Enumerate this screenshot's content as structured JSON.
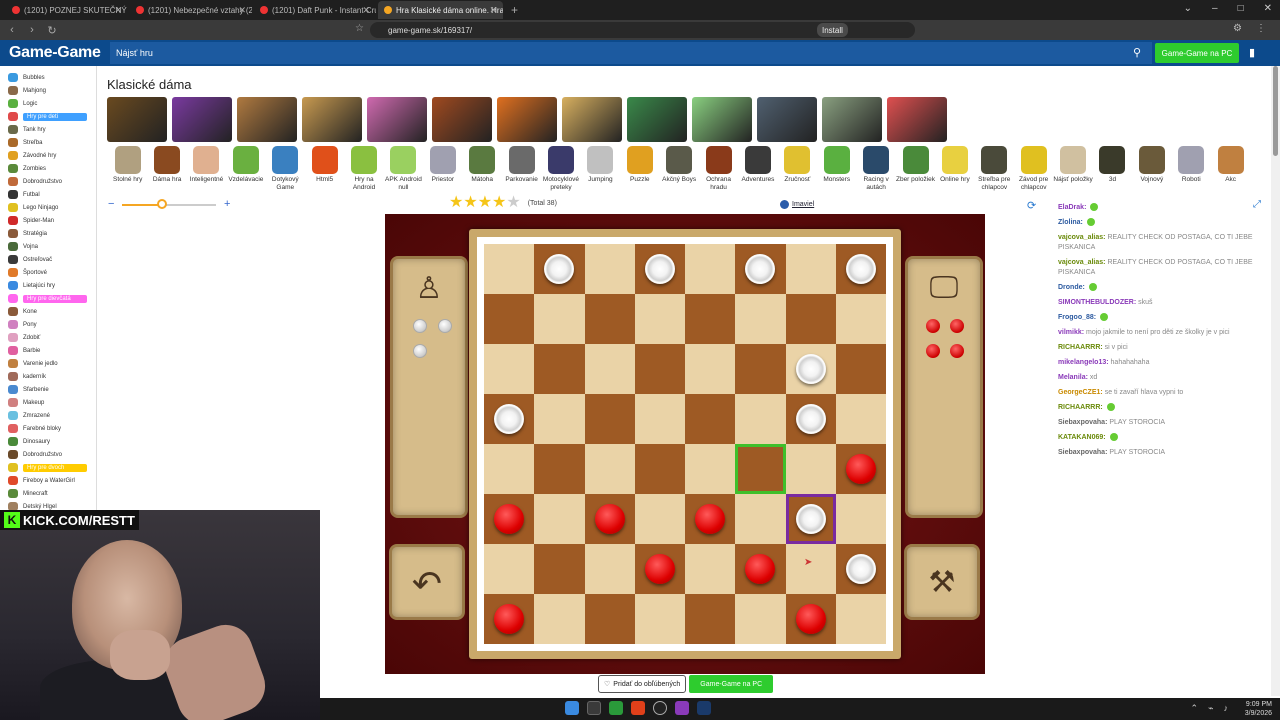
{
  "browser": {
    "tabs": [
      {
        "label": "(1201) POZNEJ SKUTEČNÝ PÁRI - Yo",
        "active": false
      },
      {
        "label": "(1201) Nebezpečné vztahy (2019/24)",
        "active": false
      },
      {
        "label": "(1201) Daft Punk - Instant Crush (Off",
        "active": false
      },
      {
        "label": "Hra Klasické dáma online. Hra",
        "active": true
      }
    ],
    "url": "game-game.sk/169317/",
    "install_label": "Install"
  },
  "site": {
    "logo": "Game-Game",
    "search_placeholder": "Nájsť hru",
    "pc_button": "Game-Game na PC"
  },
  "sidebar": {
    "items": [
      {
        "label": "Bubbles",
        "style": ""
      },
      {
        "label": "Mahjong",
        "style": ""
      },
      {
        "label": "Logic",
        "style": ""
      },
      {
        "label": "Hry pre deti",
        "style": "hl"
      },
      {
        "label": "Tank hry",
        "style": ""
      },
      {
        "label": "Streľba",
        "style": ""
      },
      {
        "label": "Závodné hry",
        "style": ""
      },
      {
        "label": "Zombies",
        "style": ""
      },
      {
        "label": "Dobrodružstvo",
        "style": ""
      },
      {
        "label": "Futbal",
        "style": ""
      },
      {
        "label": "Lego Ninjago",
        "style": ""
      },
      {
        "label": "Spider-Man",
        "style": ""
      },
      {
        "label": "Stratégia",
        "style": ""
      },
      {
        "label": "Vojna",
        "style": ""
      },
      {
        "label": "Ostreľovač",
        "style": ""
      },
      {
        "label": "Športové",
        "style": ""
      },
      {
        "label": "Lietajúci hry",
        "style": ""
      },
      {
        "label": "Hry pre dievčatá",
        "style": "pink"
      },
      {
        "label": "Kone",
        "style": ""
      },
      {
        "label": "Pony",
        "style": ""
      },
      {
        "label": "Zdobiť",
        "style": ""
      },
      {
        "label": "Barbie",
        "style": ""
      },
      {
        "label": "Varenie jedlo",
        "style": ""
      },
      {
        "label": "kaderník",
        "style": ""
      },
      {
        "label": "Sfarbenie",
        "style": ""
      },
      {
        "label": "Makeup",
        "style": ""
      },
      {
        "label": "Zmrazené",
        "style": ""
      },
      {
        "label": "Farebné bloky",
        "style": ""
      },
      {
        "label": "Dinosaury",
        "style": ""
      },
      {
        "label": "Dobrodružstvo",
        "style": ""
      },
      {
        "label": "Hry pre dvoch",
        "style": "yel"
      },
      {
        "label": "Fireboy a WaterGirl",
        "style": ""
      },
      {
        "label": "Minecraft",
        "style": ""
      },
      {
        "label": "Detský Hlgel",
        "style": ""
      }
    ]
  },
  "main": {
    "title": "Klasické dáma",
    "thumbnails": [
      {
        "color": "#6a4a20"
      },
      {
        "color": "#7a3aa0"
      },
      {
        "color": "#b07a40"
      },
      {
        "color": "#c89a50"
      },
      {
        "color": "#d06ab0"
      },
      {
        "color": "#a04a20"
      },
      {
        "color": "#e07020"
      },
      {
        "color": "#d8b060"
      },
      {
        "color": "#3a8a4a"
      },
      {
        "color": "#8ad080"
      },
      {
        "color": "#506070"
      },
      {
        "color": "#8aa080"
      },
      {
        "color": "#e05050"
      }
    ],
    "categories": [
      {
        "label": "Stolné hry",
        "color": "#b0a080"
      },
      {
        "label": "Dáma hra",
        "color": "#8a4a20"
      },
      {
        "label": "Inteligentné",
        "color": "#e0b090"
      },
      {
        "label": "Vzdelávacie",
        "color": "#6ab040"
      },
      {
        "label": "Dotykový Game",
        "color": "#3a80c0"
      },
      {
        "label": "Html5",
        "color": "#e0501a"
      },
      {
        "label": "Hry na Android",
        "color": "#8ac040"
      },
      {
        "label": "APK Android null",
        "color": "#9ad060"
      },
      {
        "label": "Priestor",
        "color": "#a0a0b0"
      },
      {
        "label": "Mátoha",
        "color": "#5a7a40"
      },
      {
        "label": "Parkovanie",
        "color": "#6a6a6a"
      },
      {
        "label": "Motocyklové preteky",
        "color": "#3a3a6a"
      },
      {
        "label": "Jumping",
        "color": "#c0c0c0"
      },
      {
        "label": "Puzzle",
        "color": "#e0a020"
      },
      {
        "label": "Akčný Boys",
        "color": "#5a5a4a"
      },
      {
        "label": "Ochrana hradu",
        "color": "#8a3a1a"
      },
      {
        "label": "Adventures",
        "color": "#3a3a3a"
      },
      {
        "label": "Zručnosť",
        "color": "#e0c030"
      },
      {
        "label": "Monsters",
        "color": "#5ab040"
      },
      {
        "label": "Racing v autách",
        "color": "#2a4a6a"
      },
      {
        "label": "Zber položiek",
        "color": "#4a8a3a"
      },
      {
        "label": "Online hry",
        "color": "#e8d040"
      },
      {
        "label": "Streľba pre chlapcov",
        "color": "#4a4a3a"
      },
      {
        "label": "Závod pre chlapcov",
        "color": "#e0c020"
      },
      {
        "label": "Nájsť položky",
        "color": "#d0c0a0"
      },
      {
        "label": "3d",
        "color": "#3a3a2a"
      },
      {
        "label": "Vojnový",
        "color": "#6a5a3a"
      },
      {
        "label": "Roboti",
        "color": "#a0a0b0"
      },
      {
        "label": "Akc",
        "color": "#c08040"
      }
    ],
    "rating": {
      "stars_filled": 4,
      "stars_total": 5,
      "total_label": "(Total 38)"
    },
    "imaviel_label": "Imaviel",
    "bottom": {
      "fav_label": "Pridať do obľúbených",
      "pc_label": "Game-Game na PC"
    }
  },
  "game": {
    "board": {
      "rows": [
        ".W.W.W.W",
        "........",
        "......W.",
        "W.....W.",
        ".......R",
        "R.R.R.W.",
        "...R.R.W",
        "R.....R."
      ],
      "highlight_green": [
        4,
        5
      ],
      "highlight_purple": [
        5,
        6
      ]
    },
    "left_captured": 3,
    "right_captured": 4
  },
  "chat": {
    "messages": [
      {
        "user": "ElaDrak:",
        "text": "",
        "ucls": ""
      },
      {
        "user": "Zlolina:",
        "text": "",
        "ucls": "b"
      },
      {
        "user": "vajcova_alias:",
        "text": "REALITY CHECK OD POSTAGA, CO TI JEBE PISKANICA",
        "ucls": "g"
      },
      {
        "user": "vajcova_alias:",
        "text": "REALITY CHECK OD POSTAGA, CO TI JEBE PISKANICA",
        "ucls": "g"
      },
      {
        "user": "Dronde:",
        "text": "",
        "ucls": "b"
      },
      {
        "user": "SIMONTHEBULDOZER:",
        "text": "skuš",
        "ucls": ""
      },
      {
        "user": "Frogoo_88:",
        "text": "",
        "ucls": "b"
      },
      {
        "user": "vilmikk:",
        "text": "mojo jakmile to není pro děti ze školky je v pici",
        "ucls": ""
      },
      {
        "user": "RICHAARRR:",
        "text": "si v pici",
        "ucls": "g"
      },
      {
        "user": "mikelangelo13:",
        "text": "hahahahaha",
        "ucls": ""
      },
      {
        "user": "Melanila:",
        "text": "xd",
        "ucls": ""
      },
      {
        "user": "GeorgeCZE1:",
        "text": "se ti zavaří hlava vypni to",
        "ucls": "o"
      },
      {
        "user": "RICHAARRR:",
        "text": "",
        "ucls": "g"
      },
      {
        "user": "Siebaxpovaha:",
        "text": "PLAY STOROCIA",
        "ucls": "gr"
      },
      {
        "user": "KATAKAN069:",
        "text": "",
        "ucls": "g"
      },
      {
        "user": "Siebaxpovaha:",
        "text": "PLAY STOROCIA",
        "ucls": "gr"
      }
    ]
  },
  "stream": {
    "kick_label": "KICK.COM/RESTT"
  },
  "taskbar": {
    "time": "9:09 PM",
    "date": "3/9/2026"
  }
}
